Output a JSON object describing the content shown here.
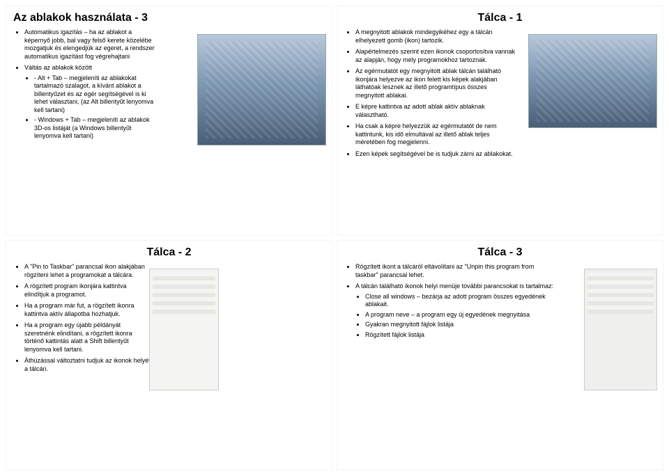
{
  "slide1": {
    "title": "Az ablakok használata - 3",
    "b1": "Automatikus igazítás – ha az ablakot a képernyő jobb, bal vagy felső kerete közelébe mozgatjuk és elengedjük az egeret, a rendszer automatikus igazítást fog végrehajtani",
    "b2": "Váltás az ablakok között",
    "b2a": "- Alt + Tab – megjeleníti az ablakokat tartalmazó szalagot, a kívánt ablakot a billentyűzet és az egér segítségével is ki lehet választani, (az Alt billentyűt lenyomva kell tartani)",
    "b2b": "- Windows + Tab – megjeleníti az ablakok 3D-os listáját (a Windows billentyűt lenyomva kell tartani)"
  },
  "slide2": {
    "title": "Tálca - 1",
    "b1": "A megnyitott ablakok mindegyikéhez egy a tálcán elhelyezett gomb (ikon) tartozik.",
    "b2": "Alapértelmezés szerint ezen ikonok csoportosítva vannak az alapján, hogy mely programokhoz tartoznak.",
    "b3": "Az egérmutatót egy megnyitott ablak tálcán található ikonjára helyezve az ikon felett kis képek alakjában láthatóak lesznek az illető programtípus összes megnyitott ablakai.",
    "b4": "E képre kattintva az adott ablak aktív ablaknak választható.",
    "b5": "Ha csak a képre helyezzük az egérmutatót de nem kattintunk, kis idő elmultával az illető ablak teljes méretében fog megjelenni.",
    "b6": "Ezen képek segítségével be is tudjuk zárni az ablakokat."
  },
  "slide3": {
    "title": "Tálca - 2",
    "b1": "A \"Pin to Taskbar\" parancsal ikon alakjában rögzíteni lehet a programokat a tálcára.",
    "b2": "A rögzített program ikonjára kattintva elindítjuk a programot.",
    "b3": "Ha a program már fut, a rögzített ikonra kattintva aktív állapotba hozhatjuk.",
    "b4": "Ha a program egy újabb példányát szeretnénk elindítani, a rögzített ikonra történő kattintás alatt a Shift billentyűt lenyomva kell tartani.",
    "b5": "Áthúzással változtatni tudjuk az ikonok helyét a tálcán."
  },
  "slide4": {
    "title": "Tálca - 3",
    "b1": "Rögzített ikont a tálcáról eltávolítani az \"Unpin this program from taskbar\" parancsal lehet.",
    "b2": "A tálcán található ikonok helyi menüje további parancsokat is tartalmaz:",
    "b2a": "Close all windows – bezárja az adott program összes egyedének ablakait.",
    "b2b": "A program neve – a program egy új egyedének megnyitása",
    "b2c": "Gyakran megnyitott fájlok listája",
    "b2d": "Rögzített fájlok listája"
  }
}
